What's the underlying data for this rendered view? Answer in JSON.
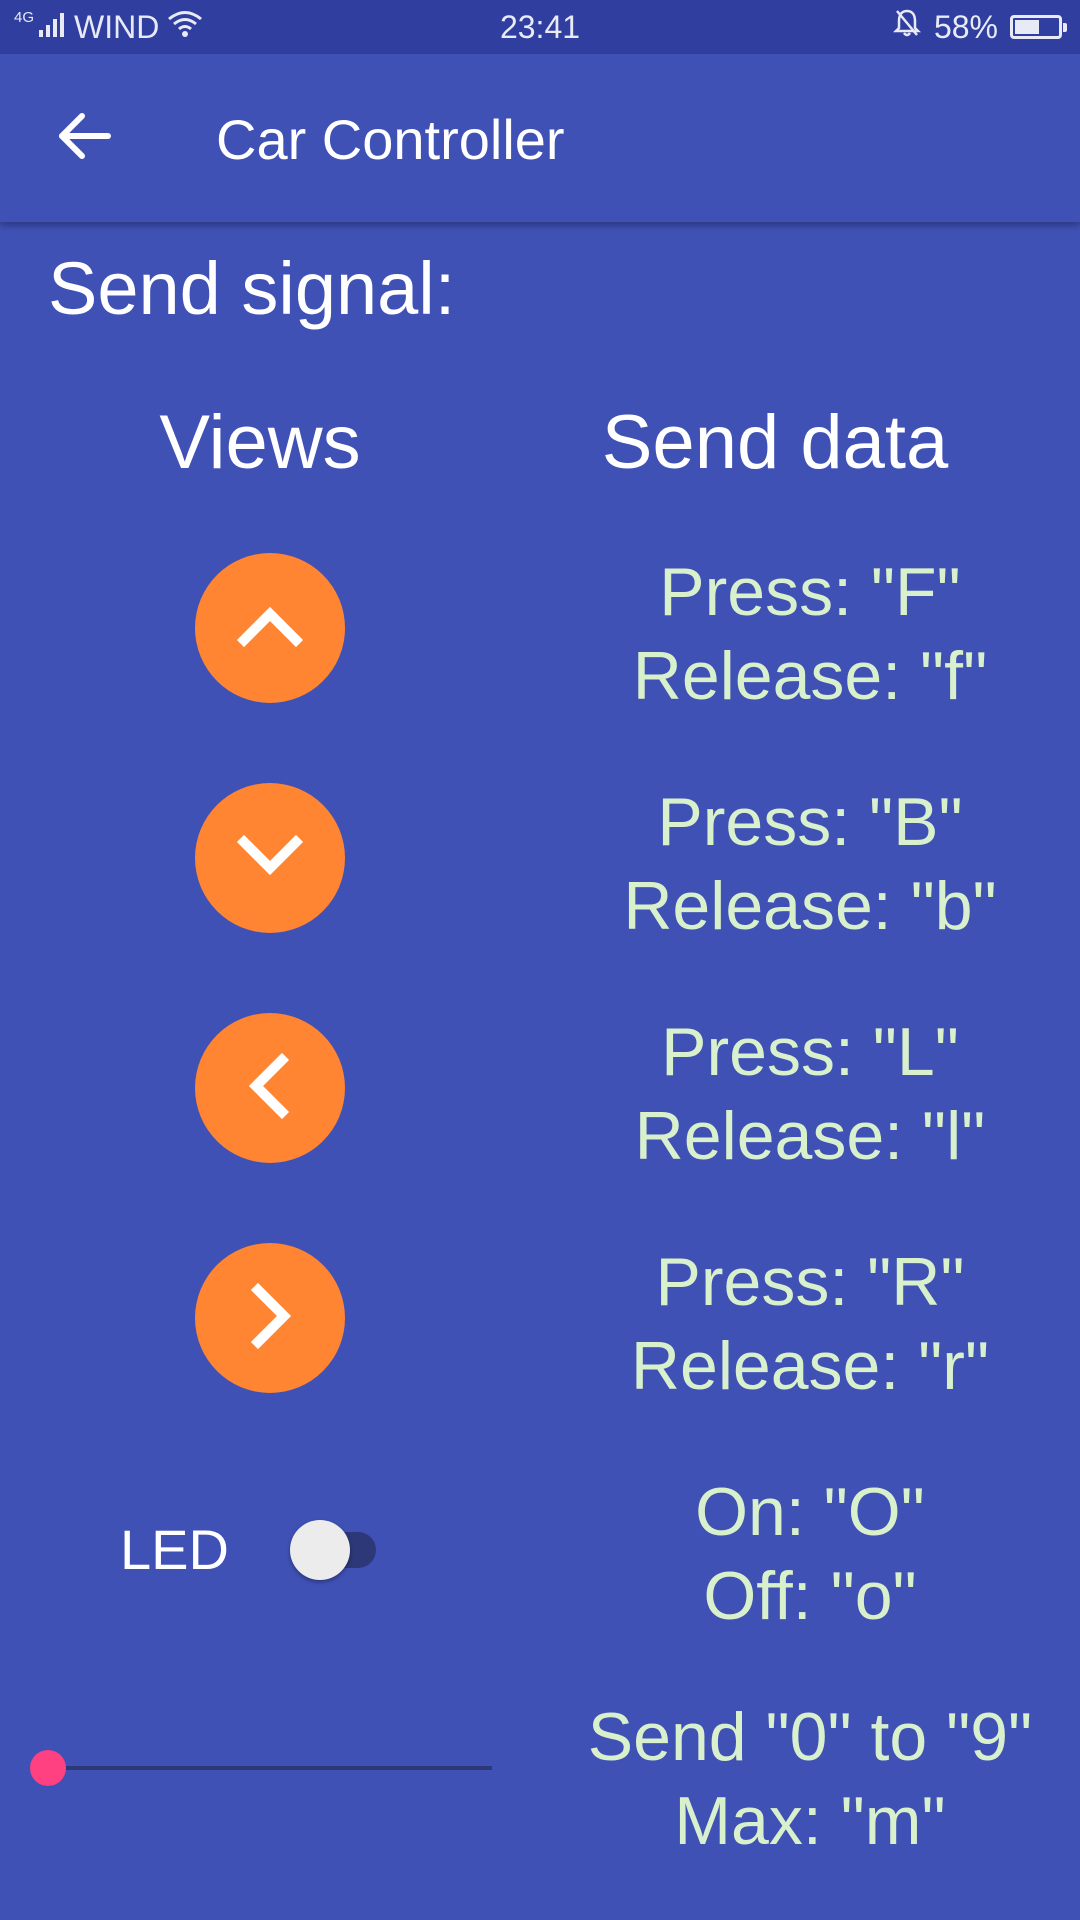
{
  "status_bar": {
    "network_type": "4G",
    "carrier": "WIND",
    "time": "23:41",
    "battery_percent_label": "58%",
    "battery_level": 0.58,
    "icons": [
      "signal-icon",
      "wifi-icon",
      "alarm-bell-icon",
      "battery-icon"
    ]
  },
  "app_bar": {
    "title": "Car Controller",
    "back_icon": "arrow-left-icon"
  },
  "content": {
    "section_title": "Send signal:",
    "column_views": "Views",
    "column_send_data": "Send data",
    "controls": [
      {
        "icon": "chevron-up-icon",
        "press": "Press: \"F\"",
        "release": "Release: \"f\""
      },
      {
        "icon": "chevron-down-icon",
        "press": "Press: \"B\"",
        "release": "Release: \"b\""
      },
      {
        "icon": "chevron-left-icon",
        "press": "Press: \"L\"",
        "release": "Release: \"l\""
      },
      {
        "icon": "chevron-right-icon",
        "press": "Press: \"R\"",
        "release": "Release: \"r\""
      }
    ],
    "led": {
      "label": "LED",
      "checked": false,
      "on_text": "On: \"O\"",
      "off_text": "Off: \"o\""
    },
    "slider": {
      "value": 0,
      "min": 0,
      "max": 9,
      "line1": "Send \"0\" to \"9\"",
      "line2": "Max: \"m\""
    }
  },
  "colors": {
    "primary": "#3f51b5",
    "primary_dark": "#303f9f",
    "fab": "#ff8533",
    "accent": "#ff4081",
    "data_text": "#d9f0cc"
  }
}
